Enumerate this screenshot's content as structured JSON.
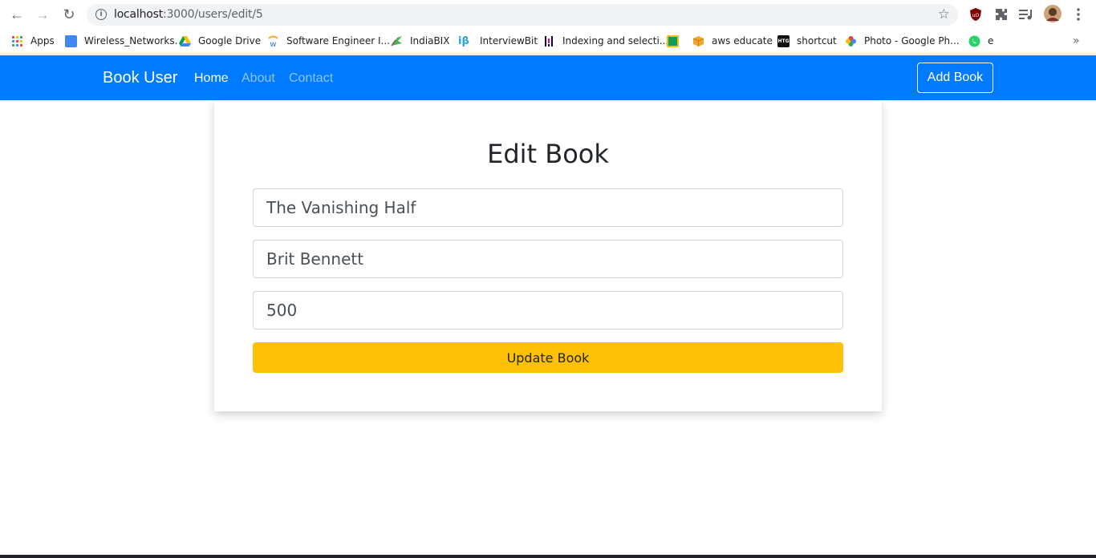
{
  "browser": {
    "url_host": "localhost",
    "url_rest": ":3000/users/edit/5",
    "bookmarks": [
      {
        "label": "Apps",
        "color": "#ea4335"
      },
      {
        "label": "Wireless_Networks.",
        "color": "#4285f4"
      },
      {
        "label": "Google Drive",
        "color": "#fbbc04"
      },
      {
        "label": "Software Engineer I...",
        "color": "#2a7de1"
      },
      {
        "label": "IndiaBIX",
        "color": "#4caf50"
      },
      {
        "label": "InterviewBit",
        "color": "#29a3d9"
      },
      {
        "label": "Indexing and selecti...",
        "color": "#3b2a6b"
      },
      {
        "label": "",
        "color": "#0f9d58"
      },
      {
        "label": "aws educate",
        "color": "#f4a62a"
      },
      {
        "label": "shortcut",
        "color": "#111111"
      },
      {
        "label": "Photo - Google Ph...",
        "color": "#ea4335"
      },
      {
        "label": "e",
        "color": "#25d366"
      }
    ]
  },
  "navbar": {
    "brand": "Book User",
    "links": [
      {
        "label": "Home",
        "active": true
      },
      {
        "label": "About",
        "active": false
      },
      {
        "label": "Contact",
        "active": false
      }
    ],
    "add_button": "Add Book"
  },
  "form": {
    "title": "Edit Book",
    "fields": [
      {
        "value": "The Vanishing Half"
      },
      {
        "value": "Brit Bennett"
      },
      {
        "value": "500"
      }
    ],
    "submit": "Update Book"
  },
  "colors": {
    "primary": "#007bff",
    "warning": "#ffc107"
  }
}
